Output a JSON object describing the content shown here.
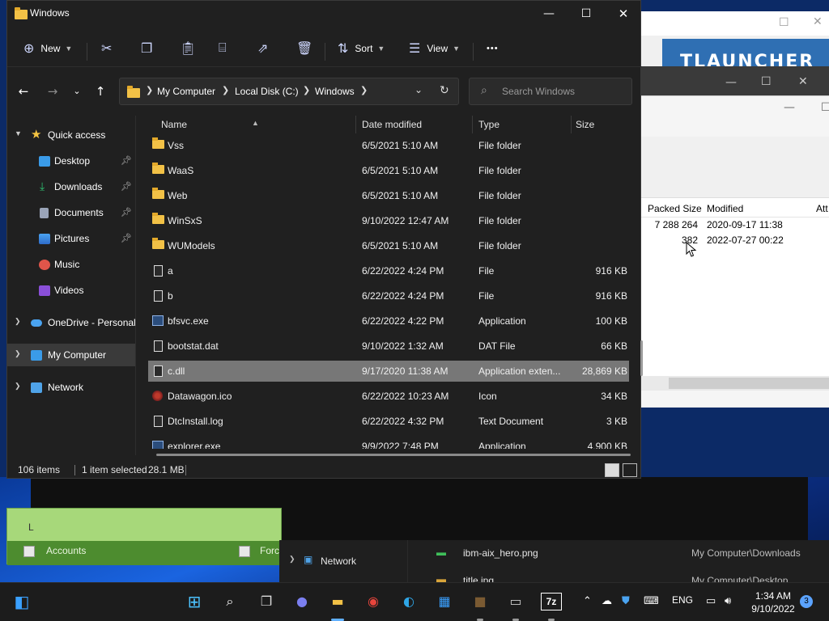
{
  "explorer": {
    "title": "Windows",
    "commands": {
      "new": "New",
      "sort": "Sort",
      "view": "View",
      "more": "•••"
    },
    "address": {
      "crumbs": [
        "My Computer",
        "Local Disk (C:)",
        "Windows"
      ]
    },
    "search": {
      "placeholder": "Search Windows"
    },
    "sidebar": [
      {
        "label": "Quick access",
        "icon": "star-icon",
        "expand": "open"
      },
      {
        "label": "Desktop",
        "icon": "desktop-icon",
        "pinned": true
      },
      {
        "label": "Downloads",
        "icon": "downloads-icon",
        "pinned": true
      },
      {
        "label": "Documents",
        "icon": "documents-icon",
        "pinned": true
      },
      {
        "label": "Pictures",
        "icon": "pictures-icon",
        "pinned": true
      },
      {
        "label": "Music",
        "icon": "music-icon"
      },
      {
        "label": "Videos",
        "icon": "videos-icon"
      },
      {
        "label": "OneDrive - Personal",
        "icon": "cloud-icon",
        "expand": "closed"
      },
      {
        "label": "My Computer",
        "icon": "computer-icon",
        "expand": "closed",
        "selected": true
      },
      {
        "label": "Network",
        "icon": "network-icon",
        "expand": "closed"
      }
    ],
    "columns": {
      "name": "Name",
      "date": "Date modified",
      "type": "Type",
      "size": "Size"
    },
    "files": [
      {
        "name": "Vss",
        "date": "6/5/2021 5:10 AM",
        "type": "File folder",
        "size": "",
        "kind": "folder"
      },
      {
        "name": "WaaS",
        "date": "6/5/2021 5:10 AM",
        "type": "File folder",
        "size": "",
        "kind": "folder"
      },
      {
        "name": "Web",
        "date": "6/5/2021 5:10 AM",
        "type": "File folder",
        "size": "",
        "kind": "folder"
      },
      {
        "name": "WinSxS",
        "date": "9/10/2022 12:47 AM",
        "type": "File folder",
        "size": "",
        "kind": "folder"
      },
      {
        "name": "WUModels",
        "date": "6/5/2021 5:10 AM",
        "type": "File folder",
        "size": "",
        "kind": "folder"
      },
      {
        "name": "a",
        "date": "6/22/2022 4:24 PM",
        "type": "File",
        "size": "916 KB",
        "kind": "file"
      },
      {
        "name": "b",
        "date": "6/22/2022 4:24 PM",
        "type": "File",
        "size": "916 KB",
        "kind": "file"
      },
      {
        "name": "bfsvc.exe",
        "date": "6/22/2022 4:22 PM",
        "type": "Application",
        "size": "100 KB",
        "kind": "app"
      },
      {
        "name": "bootstat.dat",
        "date": "9/10/2022 1:32 AM",
        "type": "DAT File",
        "size": "66 KB",
        "kind": "file"
      },
      {
        "name": "c.dll",
        "date": "9/17/2020 11:38 AM",
        "type": "Application exten...",
        "size": "28,869 KB",
        "kind": "file",
        "selected": true
      },
      {
        "name": "Datawagon.ico",
        "date": "6/22/2022 10:23 AM",
        "type": "Icon",
        "size": "34 KB",
        "kind": "ico"
      },
      {
        "name": "DtcInstall.log",
        "date": "6/22/2022 4:32 PM",
        "type": "Text Document",
        "size": "3 KB",
        "kind": "file"
      },
      {
        "name": "explorer.exe",
        "date": "9/9/2022 7:48 PM",
        "type": "Application",
        "size": "4,900 KB",
        "kind": "app"
      }
    ],
    "status": {
      "count": "106 items",
      "selected": "1 item selected",
      "size": "28.1 MB"
    }
  },
  "background": {
    "tlauncher_banner": "TLAUNCHER",
    "zip": {
      "headers": {
        "packed": "Packed Size",
        "modified": "Modified",
        "attr": "Att"
      },
      "rows": [
        {
          "packed": "7 288 264",
          "modified": "2020-09-17 11:38"
        },
        {
          "packed": "382",
          "modified": "2022-07-27 00:22"
        }
      ]
    },
    "green_panel": {
      "accounts": "Accounts",
      "force": "Forc",
      "partial": "L"
    },
    "lower": {
      "network": "Network",
      "file1": "ibm-aix_hero.png",
      "path1": "My Computer\\Downloads",
      "file2": "title.jpg",
      "path2": "My Computer\\Desktop"
    }
  },
  "taskbar": {
    "language": "ENG",
    "time": "1:34 AM",
    "date": "9/10/2022",
    "notifications": "3",
    "archiver_label": "7z"
  }
}
